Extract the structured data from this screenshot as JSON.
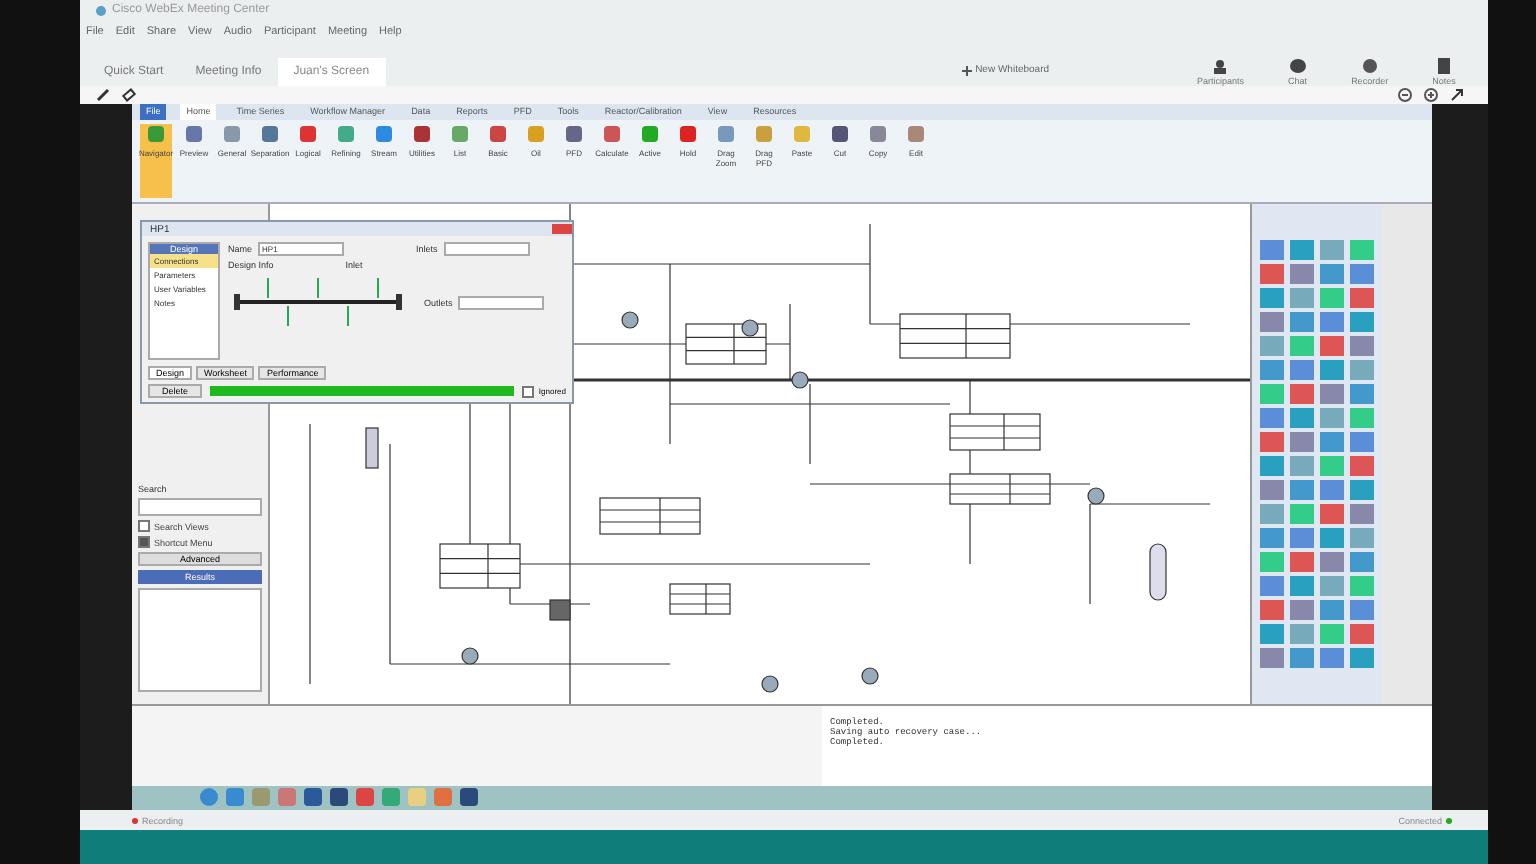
{
  "window": {
    "title": "Cisco WebEx Meeting Center"
  },
  "menu": [
    "File",
    "Edit",
    "Share",
    "View",
    "Audio",
    "Participant",
    "Meeting",
    "Help"
  ],
  "tabs": [
    {
      "label": "Quick Start",
      "selected": false
    },
    {
      "label": "Meeting Info",
      "selected": false
    },
    {
      "label": "Juan's Screen",
      "selected": true
    }
  ],
  "new_whiteboard": "New Whiteboard",
  "panels": [
    "Participants",
    "Chat",
    "Recorder",
    "Notes"
  ],
  "shared_screen": {
    "ribbon_tabs": [
      {
        "label": "File",
        "selected": false,
        "kind": "menu"
      },
      {
        "label": "Home",
        "selected": true
      },
      {
        "label": "Time Series",
        "selected": false
      },
      {
        "label": "Workflow Manager",
        "selected": false
      },
      {
        "label": "Data",
        "selected": false
      },
      {
        "label": "Reports",
        "selected": false
      },
      {
        "label": "PFD",
        "selected": false
      },
      {
        "label": "Tools",
        "selected": false
      },
      {
        "label": "Reactor/Calibration",
        "selected": false
      },
      {
        "label": "View",
        "selected": false
      },
      {
        "label": "Resources",
        "selected": false
      }
    ],
    "ribbon_buttons": [
      "Navigator",
      "Preview",
      "General",
      "Separation",
      "Logical",
      "Refining",
      "Stream",
      "Utilities",
      "List",
      "Basic",
      "Oil",
      "PFD",
      "Calculate",
      "Active",
      "Hold",
      "Drag Zoom",
      "Drag PFD",
      "Paste",
      "Cut",
      "Copy",
      "Edit"
    ],
    "dialog": {
      "title": "HP1",
      "nav_header": "Design",
      "nav": [
        {
          "label": "Connections",
          "selected": true
        },
        {
          "label": "Parameters",
          "selected": false
        },
        {
          "label": "User Variables",
          "selected": false
        },
        {
          "label": "Notes",
          "selected": false
        }
      ],
      "name_label": "Name",
      "name": "HP1",
      "design_info_label": "Design Info",
      "inlet_label": "Inlet",
      "inlets_label": "Inlets",
      "outlets_label": "Outlets",
      "tabs": [
        {
          "label": "Design",
          "selected": true
        },
        {
          "label": "Worksheet",
          "selected": false
        },
        {
          "label": "Performance",
          "selected": false
        }
      ],
      "delete": "Delete",
      "level": 1,
      "ignored": {
        "label": "Ignored",
        "checked": false
      }
    },
    "search": {
      "label": "Search",
      "options": [
        {
          "label": "Search Views",
          "checked": false
        },
        {
          "label": "Shortcut Menu",
          "checked": true
        }
      ],
      "advanced": "Advanced",
      "results": "Results"
    },
    "trace": [
      "Completed.",
      "Saving auto recovery case...",
      "Completed."
    ]
  },
  "status": {
    "recording": "Recording",
    "connected": "Connected"
  }
}
